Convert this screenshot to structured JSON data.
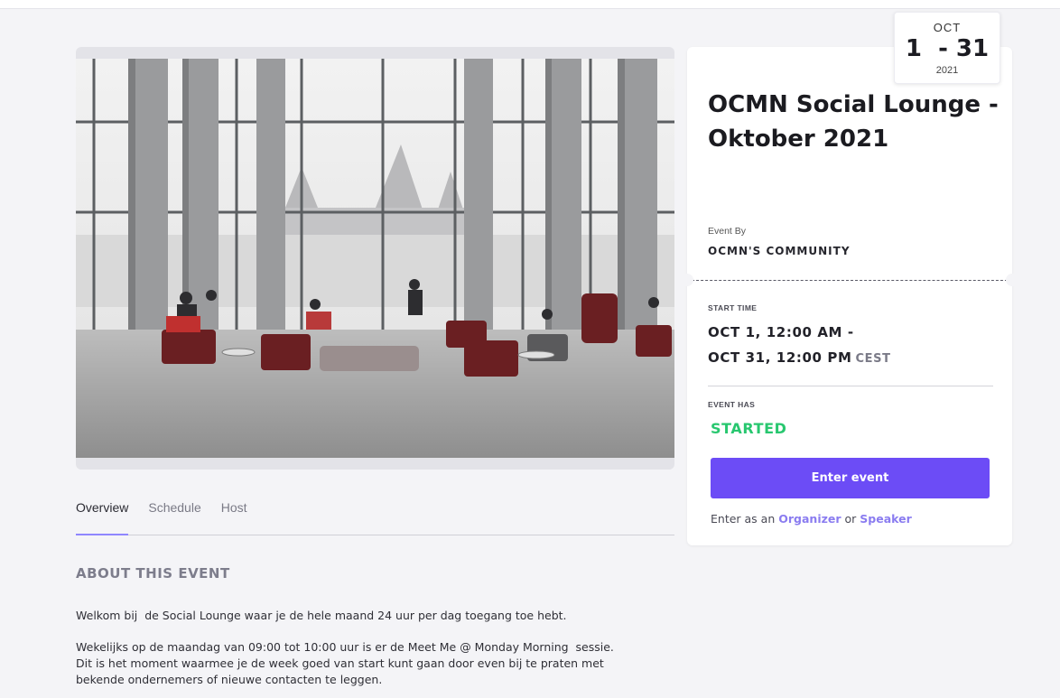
{
  "event": {
    "title": "OCMN Social Lounge - Oktober 2021",
    "hero_image_alt": "Lounge hall with tall windows and seating",
    "date_badge": {
      "month": "OCT",
      "days": "1  - 31",
      "year": "2021"
    },
    "organizer": {
      "label": "Event By",
      "name": "OCMN'S COMMUNITY"
    },
    "schedule": {
      "label": "START TIME",
      "start": "OCT 1, 12:00 AM -",
      "end": "OCT 31, 12:00 PM",
      "timezone": "CEST"
    },
    "status": {
      "label": "EVENT HAS",
      "value": "STARTED",
      "color": "#28c76f"
    },
    "enter_button": "Enter event",
    "enter_as": {
      "prefix": "Enter as an",
      "organizer_link": "Organizer",
      "conjunction": "or",
      "speaker_link": "Speaker"
    }
  },
  "tabs": [
    {
      "label": "Overview",
      "active": true
    },
    {
      "label": "Schedule",
      "active": false
    },
    {
      "label": "Host",
      "active": false
    }
  ],
  "about": {
    "title": "ABOUT THIS EVENT",
    "paragraphs": [
      "Welkom bij  de Social Lounge waar je de hele maand 24 uur per dag toegang toe hebt.",
      "Wekelijks op de maandag van 09:00 tot 10:00 uur is er de Meet Me @ Monday Morning  sessie.\nDit is het moment waarmee je de week goed van start kunt gaan door even bij te praten met\nbekende ondernemers of nieuwe contacten te leggen."
    ]
  },
  "colors": {
    "accent": "#6c4cf6",
    "link": "#8a7cf0",
    "page_bg": "#f4f4f7",
    "status_green": "#28c76f"
  }
}
